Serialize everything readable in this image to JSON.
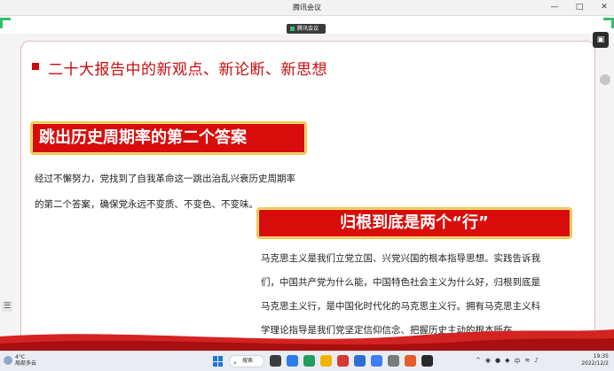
{
  "window": {
    "title": "腾讯会议",
    "minimize_glyph": "—",
    "maximize_glyph": "□",
    "close_glyph": "✕"
  },
  "share_badge": {
    "label": "腾讯会议"
  },
  "slide": {
    "title": "二十大报告中的新观点、新论断、新思想",
    "banner1": "跳出历史周期率的第二个答案",
    "para1": [
      "经过不懈努力，党找到了自我革命这一跳出治乱兴衰历史周期率",
      "的第二个答案，确保党永远不变质、不变色、不变味。"
    ],
    "banner2": "归根到底是两个“行”",
    "para2": [
      "马克思主义是我们立党立国、兴党兴国的根本指导思想。实践告诉我",
      "们，中国共产党为什么能，中国特色社会主义为什么好，归根到底是",
      "马克思主义行，是中国化时代化的马克思主义行。拥有马克思主义科",
      "学理论指导是我们党坚定信仰信念、把握历史主动的根本所在。"
    ]
  },
  "taskbar": {
    "weather_temp": "4°C",
    "weather_desc": "局部多云",
    "search_label": "搜索",
    "tray_lang": "中",
    "time": "19:35",
    "date": "2022/12/2"
  },
  "colors": {
    "accent_red": "#d90c0c",
    "title_red": "#c90b0b",
    "banner_border": "#f2c94c",
    "share_green": "#2fc26a"
  },
  "icons": [
    "minimize-icon",
    "maximize-icon",
    "close-icon",
    "windows-start-icon",
    "search-icon",
    "weather-icon"
  ]
}
